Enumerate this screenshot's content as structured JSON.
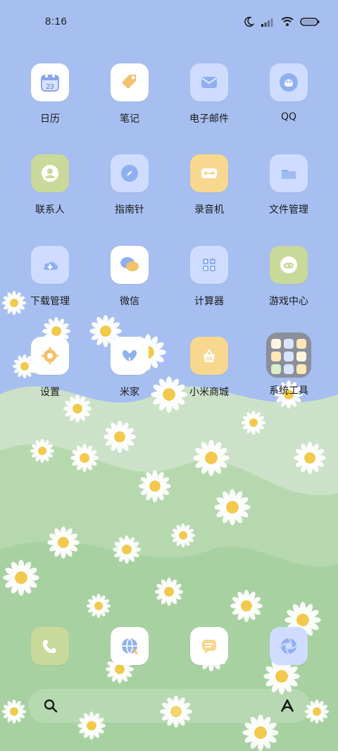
{
  "status_bar": {
    "time": "8:16",
    "icons": [
      "moon-icon",
      "signal-icon",
      "wifi-icon",
      "battery-icon"
    ]
  },
  "apps": [
    {
      "label": "日历",
      "icon": "calendar-icon",
      "badge_text": "23"
    },
    {
      "label": "笔记",
      "icon": "tag-icon"
    },
    {
      "label": "电子邮件",
      "icon": "mail-icon"
    },
    {
      "label": "QQ",
      "icon": "qq-penguin-icon"
    },
    {
      "label": "联系人",
      "icon": "contact-icon"
    },
    {
      "label": "指南针",
      "icon": "compass-icon"
    },
    {
      "label": "录音机",
      "icon": "recorder-icon"
    },
    {
      "label": "文件管理",
      "icon": "folder-icon"
    },
    {
      "label": "下载管理",
      "icon": "cloud-download-icon"
    },
    {
      "label": "微信",
      "icon": "wechat-icon"
    },
    {
      "label": "计算器",
      "icon": "calculator-icon"
    },
    {
      "label": "游戏中心",
      "icon": "gamepad-icon"
    },
    {
      "label": "设置",
      "icon": "gear-icon"
    },
    {
      "label": "米家",
      "icon": "heart-home-icon"
    },
    {
      "label": "小米商城",
      "icon": "shopping-basket-icon"
    },
    {
      "label": "系统工具",
      "icon": "folder-grid-icon"
    }
  ],
  "dock": [
    {
      "name": "phone",
      "icon": "phone-icon"
    },
    {
      "name": "browser",
      "icon": "globe-icon"
    },
    {
      "name": "messages",
      "icon": "message-icon"
    },
    {
      "name": "camera",
      "icon": "camera-aperture-icon"
    }
  ],
  "bottom_bar": {
    "left_icon": "search-icon",
    "right_icon": "assistant-icon"
  },
  "colors": {
    "sky": "#a7bff0",
    "petal": "#ffffff",
    "flower_center": "#f2c94c",
    "leaf": "#9ec98a"
  }
}
